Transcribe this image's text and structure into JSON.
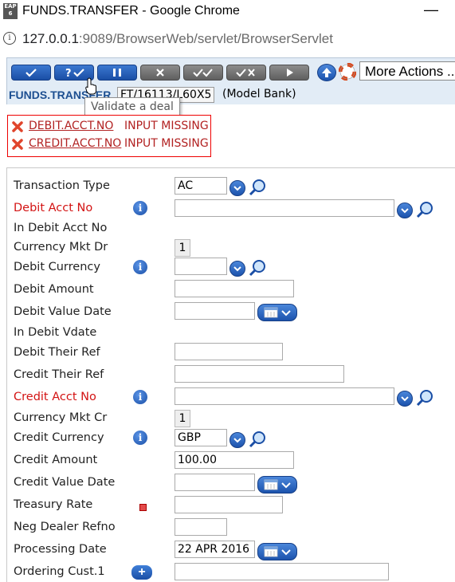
{
  "window": {
    "icon_label": "EAP 6",
    "title": "FUNDS.TRANSFER - Google Chrome",
    "minimize": "—"
  },
  "address": {
    "host": "127.0.0.1",
    "path": ":9089/BrowserWeb/servlet/BrowserServlet"
  },
  "toolbar": {
    "more_actions": "More Actions ...",
    "app_name": "FUNDS.TRANSFER",
    "txn_id": "FT/16113/L60X5",
    "company": "(Model Bank)",
    "tooltip": "Validate a deal"
  },
  "errors": [
    {
      "field": "DEBIT.ACCT.NO",
      "message": "INPUT MISSING"
    },
    {
      "field": "CREDIT.ACCT.NO",
      "message": "INPUT MISSING"
    }
  ],
  "form": {
    "transaction_type": {
      "label": "Transaction Type",
      "value": "AC"
    },
    "debit_acct_no": {
      "label": "Debit Acct No",
      "value": ""
    },
    "in_debit_acct_no": {
      "label": "In Debit Acct No"
    },
    "currency_mkt_dr": {
      "label": "Currency Mkt Dr",
      "value": "1"
    },
    "debit_currency": {
      "label": "Debit Currency",
      "value": ""
    },
    "debit_amount": {
      "label": "Debit Amount",
      "value": ""
    },
    "debit_value_date": {
      "label": "Debit Value Date",
      "value": ""
    },
    "in_debit_vdate": {
      "label": "In Debit Vdate"
    },
    "debit_their_ref": {
      "label": "Debit Their Ref",
      "value": ""
    },
    "credit_their_ref": {
      "label": "Credit Their Ref",
      "value": ""
    },
    "credit_acct_no": {
      "label": "Credit Acct No",
      "value": ""
    },
    "currency_mkt_cr": {
      "label": "Currency Mkt Cr",
      "value": "1"
    },
    "credit_currency": {
      "label": "Credit Currency",
      "value": "GBP"
    },
    "credit_amount": {
      "label": "Credit Amount",
      "value": "100.00"
    },
    "credit_value_date": {
      "label": "Credit Value Date",
      "value": ""
    },
    "treasury_rate": {
      "label": "Treasury Rate",
      "value": ""
    },
    "neg_dealer_refno": {
      "label": "Neg Dealer Refno",
      "value": ""
    },
    "processing_date": {
      "label": "Processing Date",
      "value": "22 APR 2016"
    },
    "ordering_cust_1": {
      "label": "Ordering Cust.1",
      "value": ""
    }
  },
  "colors": {
    "mandatory_label": "#d31313",
    "error": "#b22222",
    "toolbar_bg": "#e2ecf6",
    "button_blue": "#1a4ea5"
  }
}
